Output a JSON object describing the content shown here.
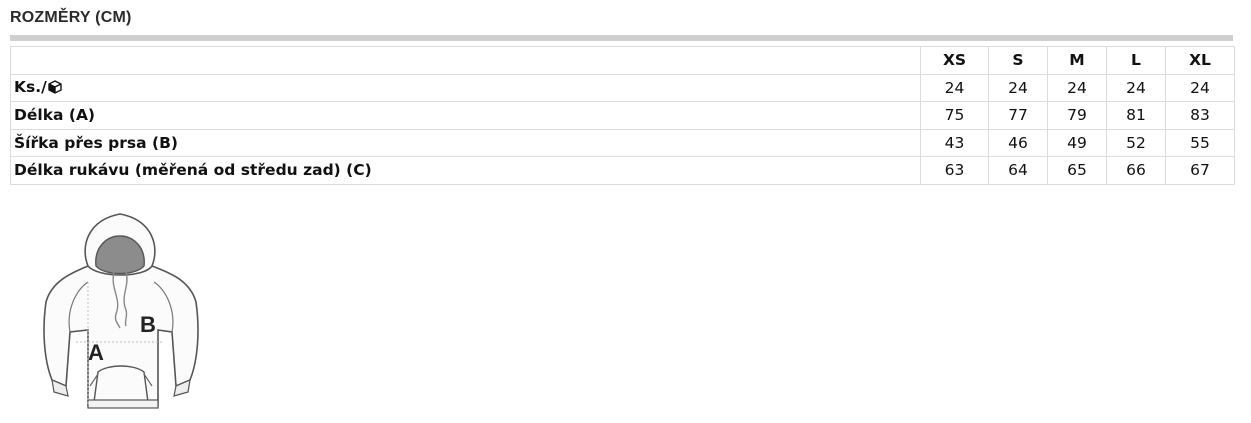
{
  "title": "ROZMĚRY (CM)",
  "table": {
    "headers": [
      "XS",
      "S",
      "M",
      "L",
      "XL"
    ],
    "rows": [
      {
        "label": "Ks./",
        "icon": "box-icon",
        "values": [
          "24",
          "24",
          "24",
          "24",
          "24"
        ]
      },
      {
        "label": "Délka (A)",
        "values": [
          "75",
          "77",
          "79",
          "81",
          "83"
        ]
      },
      {
        "label": "Šířka přes prsa (B)",
        "values": [
          "43",
          "46",
          "49",
          "52",
          "55"
        ]
      },
      {
        "label": "Délka rukávu (měřená od středu zad) (C)",
        "values": [
          "63",
          "64",
          "65",
          "66",
          "67"
        ]
      }
    ]
  },
  "illustration": {
    "icon": "hoodie-measurement-diagram",
    "label_a": "A",
    "label_b": "B"
  }
}
